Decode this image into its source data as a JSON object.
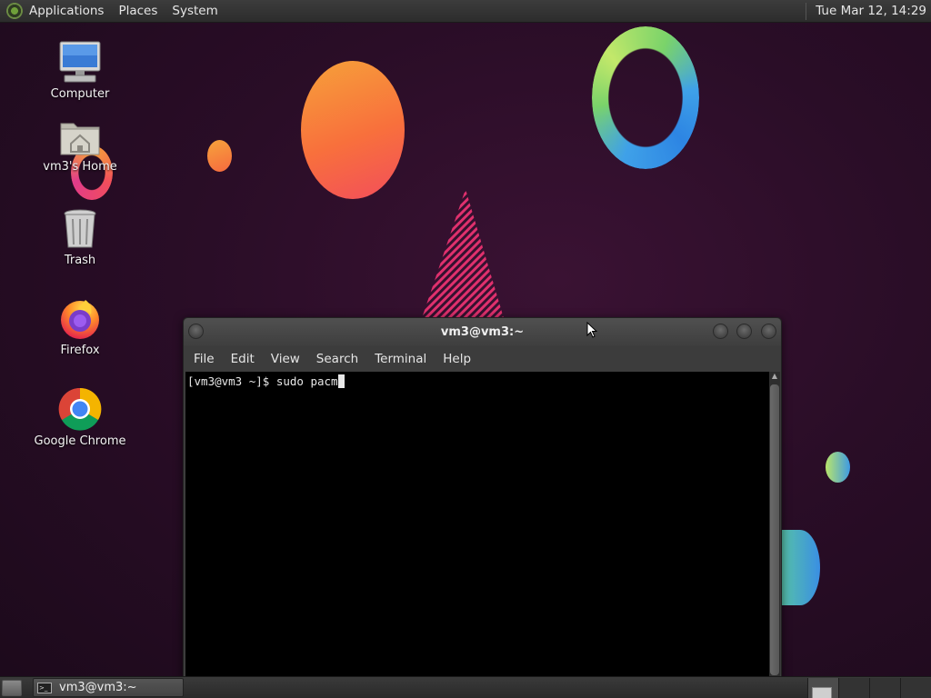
{
  "top_panel": {
    "menus": [
      "Applications",
      "Places",
      "System"
    ],
    "clock": "Tue Mar 12, 14:29"
  },
  "desktop_icons": [
    {
      "label": "Computer",
      "icon": "computer-icon"
    },
    {
      "label": "vm3's Home",
      "icon": "home-folder-icon"
    },
    {
      "label": "Trash",
      "icon": "trash-icon"
    },
    {
      "label": "Firefox",
      "icon": "firefox-icon"
    },
    {
      "label": "Google Chrome",
      "icon": "chrome-icon"
    }
  ],
  "terminal": {
    "title": "vm3@vm3:~",
    "menus": [
      "File",
      "Edit",
      "View",
      "Search",
      "Terminal",
      "Help"
    ],
    "prompt": "[vm3@vm3 ~]$ ",
    "command": "sudo pacm"
  },
  "taskbar": {
    "window_label": "vm3@vm3:~"
  },
  "colors": {
    "wallpaper": "#2a0d27",
    "panel": "#333333",
    "terminal_bg": "#000000"
  }
}
